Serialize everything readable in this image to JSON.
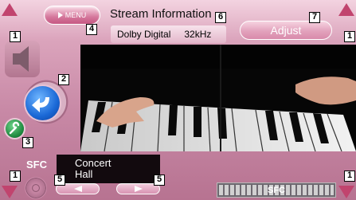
{
  "header": {
    "menu_label": "MENU",
    "title": "Stream Information",
    "info": {
      "format": "Dolby Digital",
      "sample_rate": "32kHz"
    },
    "adjust_label": "Adjust"
  },
  "sfc": {
    "label": "SFC",
    "mode_line1": "Concert",
    "mode_line2": "Hall",
    "meter_label": "SFC"
  },
  "callouts": {
    "c1_tl": "1",
    "c1_tr": "1",
    "c1_bl": "1",
    "c1_br": "1",
    "c2": "2",
    "c3": "3",
    "c4": "4",
    "c5_left": "5",
    "c5_right": "5",
    "c6": "6",
    "c7": "7"
  },
  "icons": {
    "speaker": "speaker-icon",
    "return": "return-arrow-icon",
    "tool": "wrench-icon",
    "disc": "disc-icon"
  },
  "colors": {
    "accent_pink": "#c1446e",
    "return_blue": "#1a68d6",
    "tool_green": "#1e8a3f"
  }
}
